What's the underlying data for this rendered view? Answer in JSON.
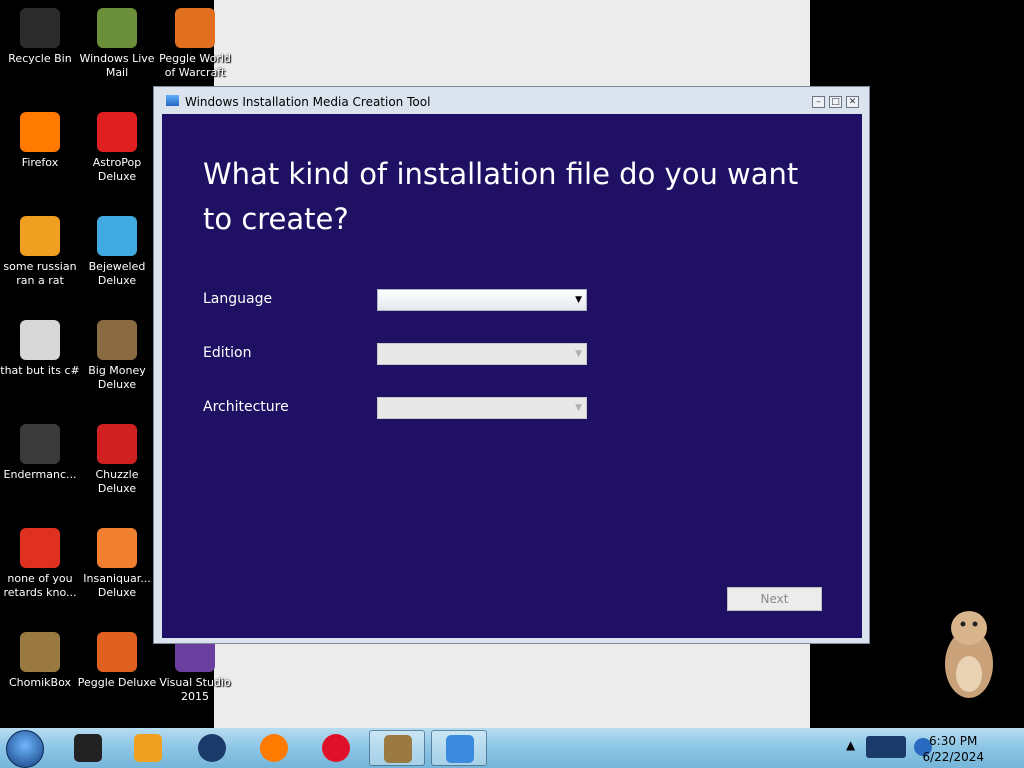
{
  "desktop": {
    "icons": [
      {
        "label": "Recycle Bin",
        "color": "#2b2b2b"
      },
      {
        "label": "Windows Live Mail",
        "color": "#6c8f3c"
      },
      {
        "label": "Peggle World of Warcraft",
        "color": "#e07020"
      },
      {
        "label": "Firefox",
        "color": "#ff7a00"
      },
      {
        "label": "AstroPop Deluxe",
        "color": "#e02020"
      },
      {
        "label": "some russian ran a rat",
        "color": "#f0a020"
      },
      {
        "label": "Bejeweled Deluxe",
        "color": "#3fa9e0"
      },
      {
        "label": "that but its c#",
        "color": "#d8d8d8"
      },
      {
        "label": "Big Money Deluxe",
        "color": "#8a6a40"
      },
      {
        "label": "Endermanc...",
        "color": "#3a3a3a"
      },
      {
        "label": "Chuzzle Deluxe",
        "color": "#d02020"
      },
      {
        "label": "none of you retards kno...",
        "color": "#e03020"
      },
      {
        "label": "Insaniquar... Deluxe",
        "color": "#f08030"
      },
      {
        "label": "ChomikBox",
        "color": "#9a7a40"
      },
      {
        "label": "Peggle Deluxe",
        "color": "#e06020"
      },
      {
        "label": "Visual Studio 2015",
        "color": "#6a3fa0"
      }
    ]
  },
  "window": {
    "title": "Windows Installation Media Creation Tool",
    "heading": "What kind of installation file do you want to create?",
    "fields": [
      {
        "label": "Language",
        "value": "",
        "enabled": true
      },
      {
        "label": "Edition",
        "value": "",
        "enabled": false
      },
      {
        "label": "Architecture",
        "value": "",
        "enabled": false
      }
    ],
    "next_label": "Next",
    "colors": {
      "client_bg": "#201064"
    }
  },
  "taskbar": {
    "pinned": [
      {
        "name": "tablet-app-icon",
        "color": "#222222"
      },
      {
        "name": "media-player-icon",
        "color": "#f0a020"
      },
      {
        "name": "globe-app-icon",
        "color": "#1a3a6a"
      },
      {
        "name": "firefox-icon",
        "color": "#ff7a00"
      },
      {
        "name": "opera-icon",
        "color": "#e0102a"
      },
      {
        "name": "chomikbox-icon",
        "color": "#9a7a40"
      },
      {
        "name": "media-tool-icon",
        "color": "#3c8adf"
      }
    ],
    "time": "6:30 PM",
    "date": "6/22/2024",
    "tray_arrow": "▲"
  }
}
